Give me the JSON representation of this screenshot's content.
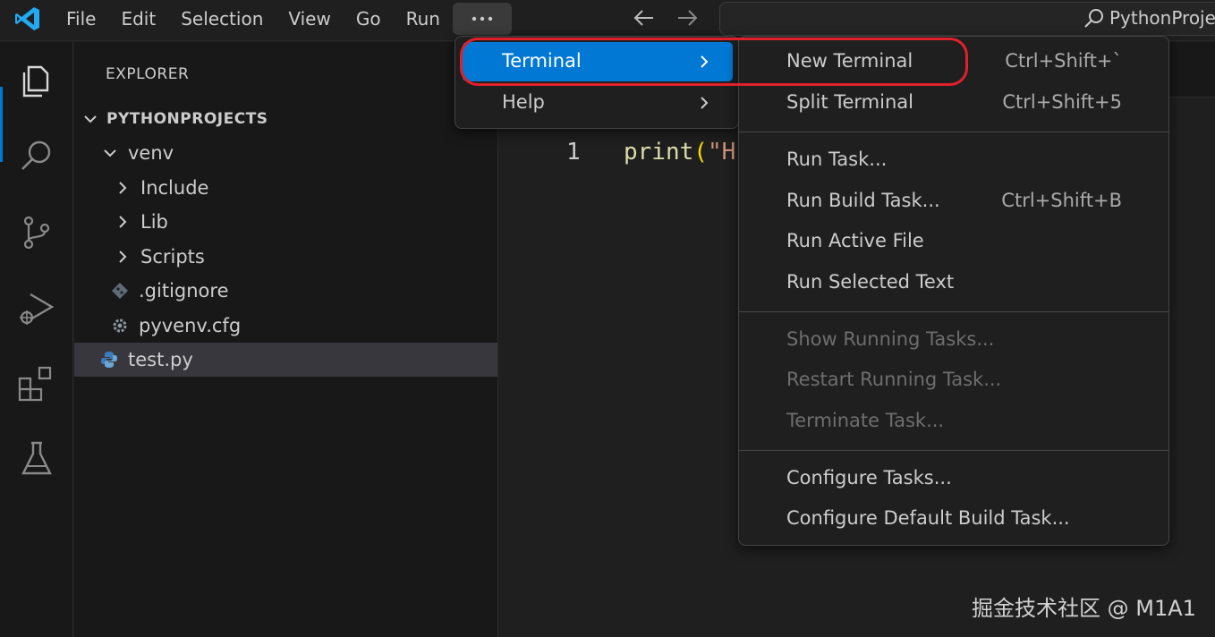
{
  "menubar": {
    "items": [
      "File",
      "Edit",
      "Selection",
      "View",
      "Go",
      "Run"
    ],
    "more_label": "···"
  },
  "command_center": {
    "label": "PythonProjects"
  },
  "explorer": {
    "title": "EXPLORER",
    "root": "PYTHONPROJECTS",
    "tree": [
      {
        "label": "venv",
        "type": "folder-open"
      },
      {
        "label": "Include",
        "type": "folder"
      },
      {
        "label": "Lib",
        "type": "folder"
      },
      {
        "label": "Scripts",
        "type": "folder"
      },
      {
        "label": ".gitignore",
        "type": "git-file"
      },
      {
        "label": "pyvenv.cfg",
        "type": "config-file"
      },
      {
        "label": "test.py",
        "type": "python-file"
      }
    ]
  },
  "editor": {
    "line_number": "1",
    "code_fn": "print",
    "code_paren": "(",
    "code_str": "\"H"
  },
  "menu_primary": {
    "items": [
      {
        "label": "Terminal",
        "active": true
      },
      {
        "label": "Help",
        "active": false
      }
    ]
  },
  "menu_terminal": {
    "items": [
      {
        "label": "New Terminal",
        "shortcut": "Ctrl+Shift+`",
        "disabled": false
      },
      {
        "label": "Split Terminal",
        "shortcut": "Ctrl+Shift+5",
        "disabled": false
      },
      {
        "label": "Run Task...",
        "shortcut": "",
        "disabled": false
      },
      {
        "label": "Run Build Task...",
        "shortcut": "Ctrl+Shift+B",
        "disabled": false
      },
      {
        "label": "Run Active File",
        "shortcut": "",
        "disabled": false
      },
      {
        "label": "Run Selected Text",
        "shortcut": "",
        "disabled": false
      },
      {
        "label": "Show Running Tasks...",
        "shortcut": "",
        "disabled": true
      },
      {
        "label": "Restart Running Task...",
        "shortcut": "",
        "disabled": true
      },
      {
        "label": "Terminate Task...",
        "shortcut": "",
        "disabled": true
      },
      {
        "label": "Configure Tasks...",
        "shortcut": "",
        "disabled": false
      },
      {
        "label": "Configure Default Build Task...",
        "shortcut": "",
        "disabled": false
      }
    ]
  },
  "watermark": "掘金技术社区 @ M1A1",
  "colors": {
    "accent": "#0078d4",
    "highlight_ring": "#e0202a",
    "python_icon": "#3d7ab8",
    "vscode_logo": "#23a9f2"
  }
}
